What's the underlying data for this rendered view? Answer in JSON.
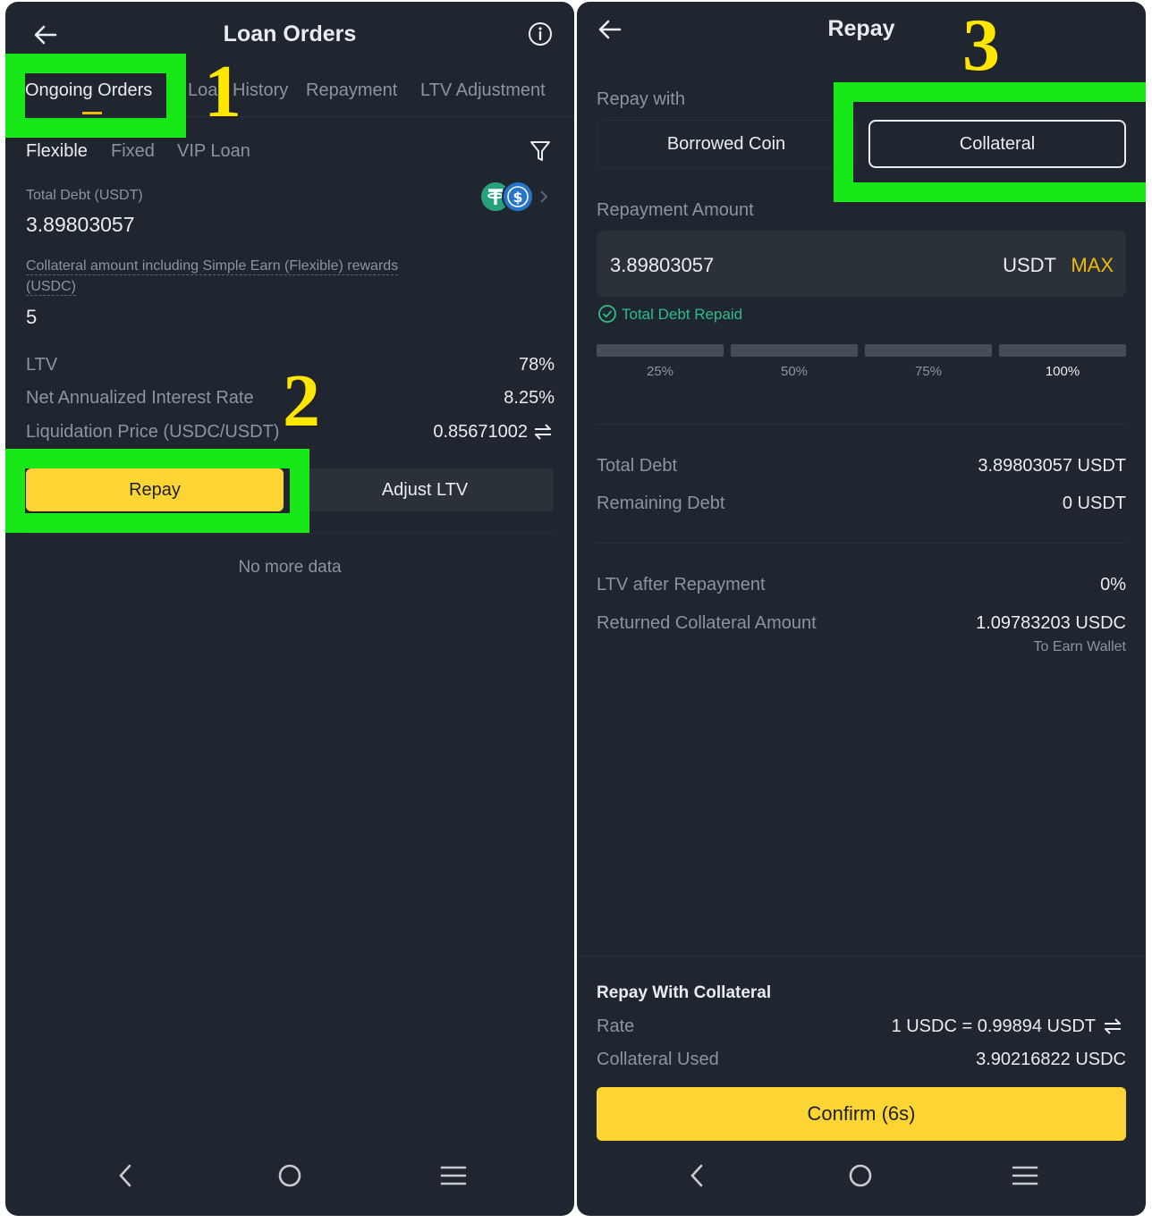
{
  "left": {
    "title": "Loan Orders",
    "tabs": [
      {
        "label": "Ongoing Orders",
        "active": true
      },
      {
        "label": "Loan History",
        "active": false
      },
      {
        "label": "Repayment",
        "active": false
      },
      {
        "label": "LTV Adjustment",
        "active": false
      }
    ],
    "sub_tabs": [
      {
        "label": "Flexible",
        "active": true
      },
      {
        "label": "Fixed",
        "active": false
      },
      {
        "label": "VIP Loan",
        "active": false
      }
    ],
    "total_debt_label": "Total Debt (USDT)",
    "total_debt_value": "3.89803057",
    "collateral_label": "Collateral amount including Simple Earn (Flexible) rewards",
    "collateral_label_2": "(USDC)",
    "collateral_value": "5",
    "rows": [
      {
        "label": "LTV",
        "value": "78%"
      },
      {
        "label": "Net Annualized Interest Rate",
        "value": "8.25%"
      },
      {
        "label": "Liquidation Price (USDC/USDT)",
        "value": "0.85671002"
      }
    ],
    "repay_button": "Repay",
    "adjust_button": "Adjust LTV",
    "no_more": "No more data"
  },
  "right": {
    "title": "Repay",
    "repay_with_label": "Repay with",
    "options": [
      "Borrowed Coin",
      "Collateral"
    ],
    "selected_option": "Collateral",
    "repayment_amount_label": "Repayment Amount",
    "amount_value": "3.89803057",
    "amount_unit": "USDT",
    "max_label": "MAX",
    "total_debt_repaid": "Total Debt Repaid",
    "percents": [
      "25%",
      "50%",
      "75%",
      "100%"
    ],
    "selected_percent": "100%",
    "summary1": [
      {
        "label": "Total Debt",
        "value": "3.89803057 USDT"
      },
      {
        "label": "Remaining Debt",
        "value": "0 USDT"
      }
    ],
    "ltv_after_label": "LTV after Repayment",
    "ltv_after_value": "0%",
    "returned_label": "Returned Collateral Amount",
    "returned_value": "1.09783203 USDC",
    "returned_note": "To Earn Wallet",
    "collateral_section_title": "Repay With Collateral",
    "rate_label": "Rate",
    "rate_value": "1 USDC = 0.99894 USDT",
    "collateral_used_label": "Collateral Used",
    "collateral_used_value": "3.90216822 USDC",
    "confirm_button": "Confirm (6s)"
  },
  "annotations": {
    "step1": "1",
    "step2": "2",
    "step3": "3"
  },
  "colors": {
    "background": "#1f2630",
    "accent": "#f0b90b",
    "button": "#fcd535",
    "highlight": "#18e818",
    "success": "#2ebd85"
  },
  "icons": [
    "back-arrow-icon",
    "info-icon",
    "filter-icon",
    "usdt-coin-icon",
    "usdc-coin-icon",
    "chevron-right-icon",
    "swap-icon",
    "check-circle-icon",
    "nav-back-icon",
    "nav-home-icon",
    "nav-menu-icon"
  ]
}
